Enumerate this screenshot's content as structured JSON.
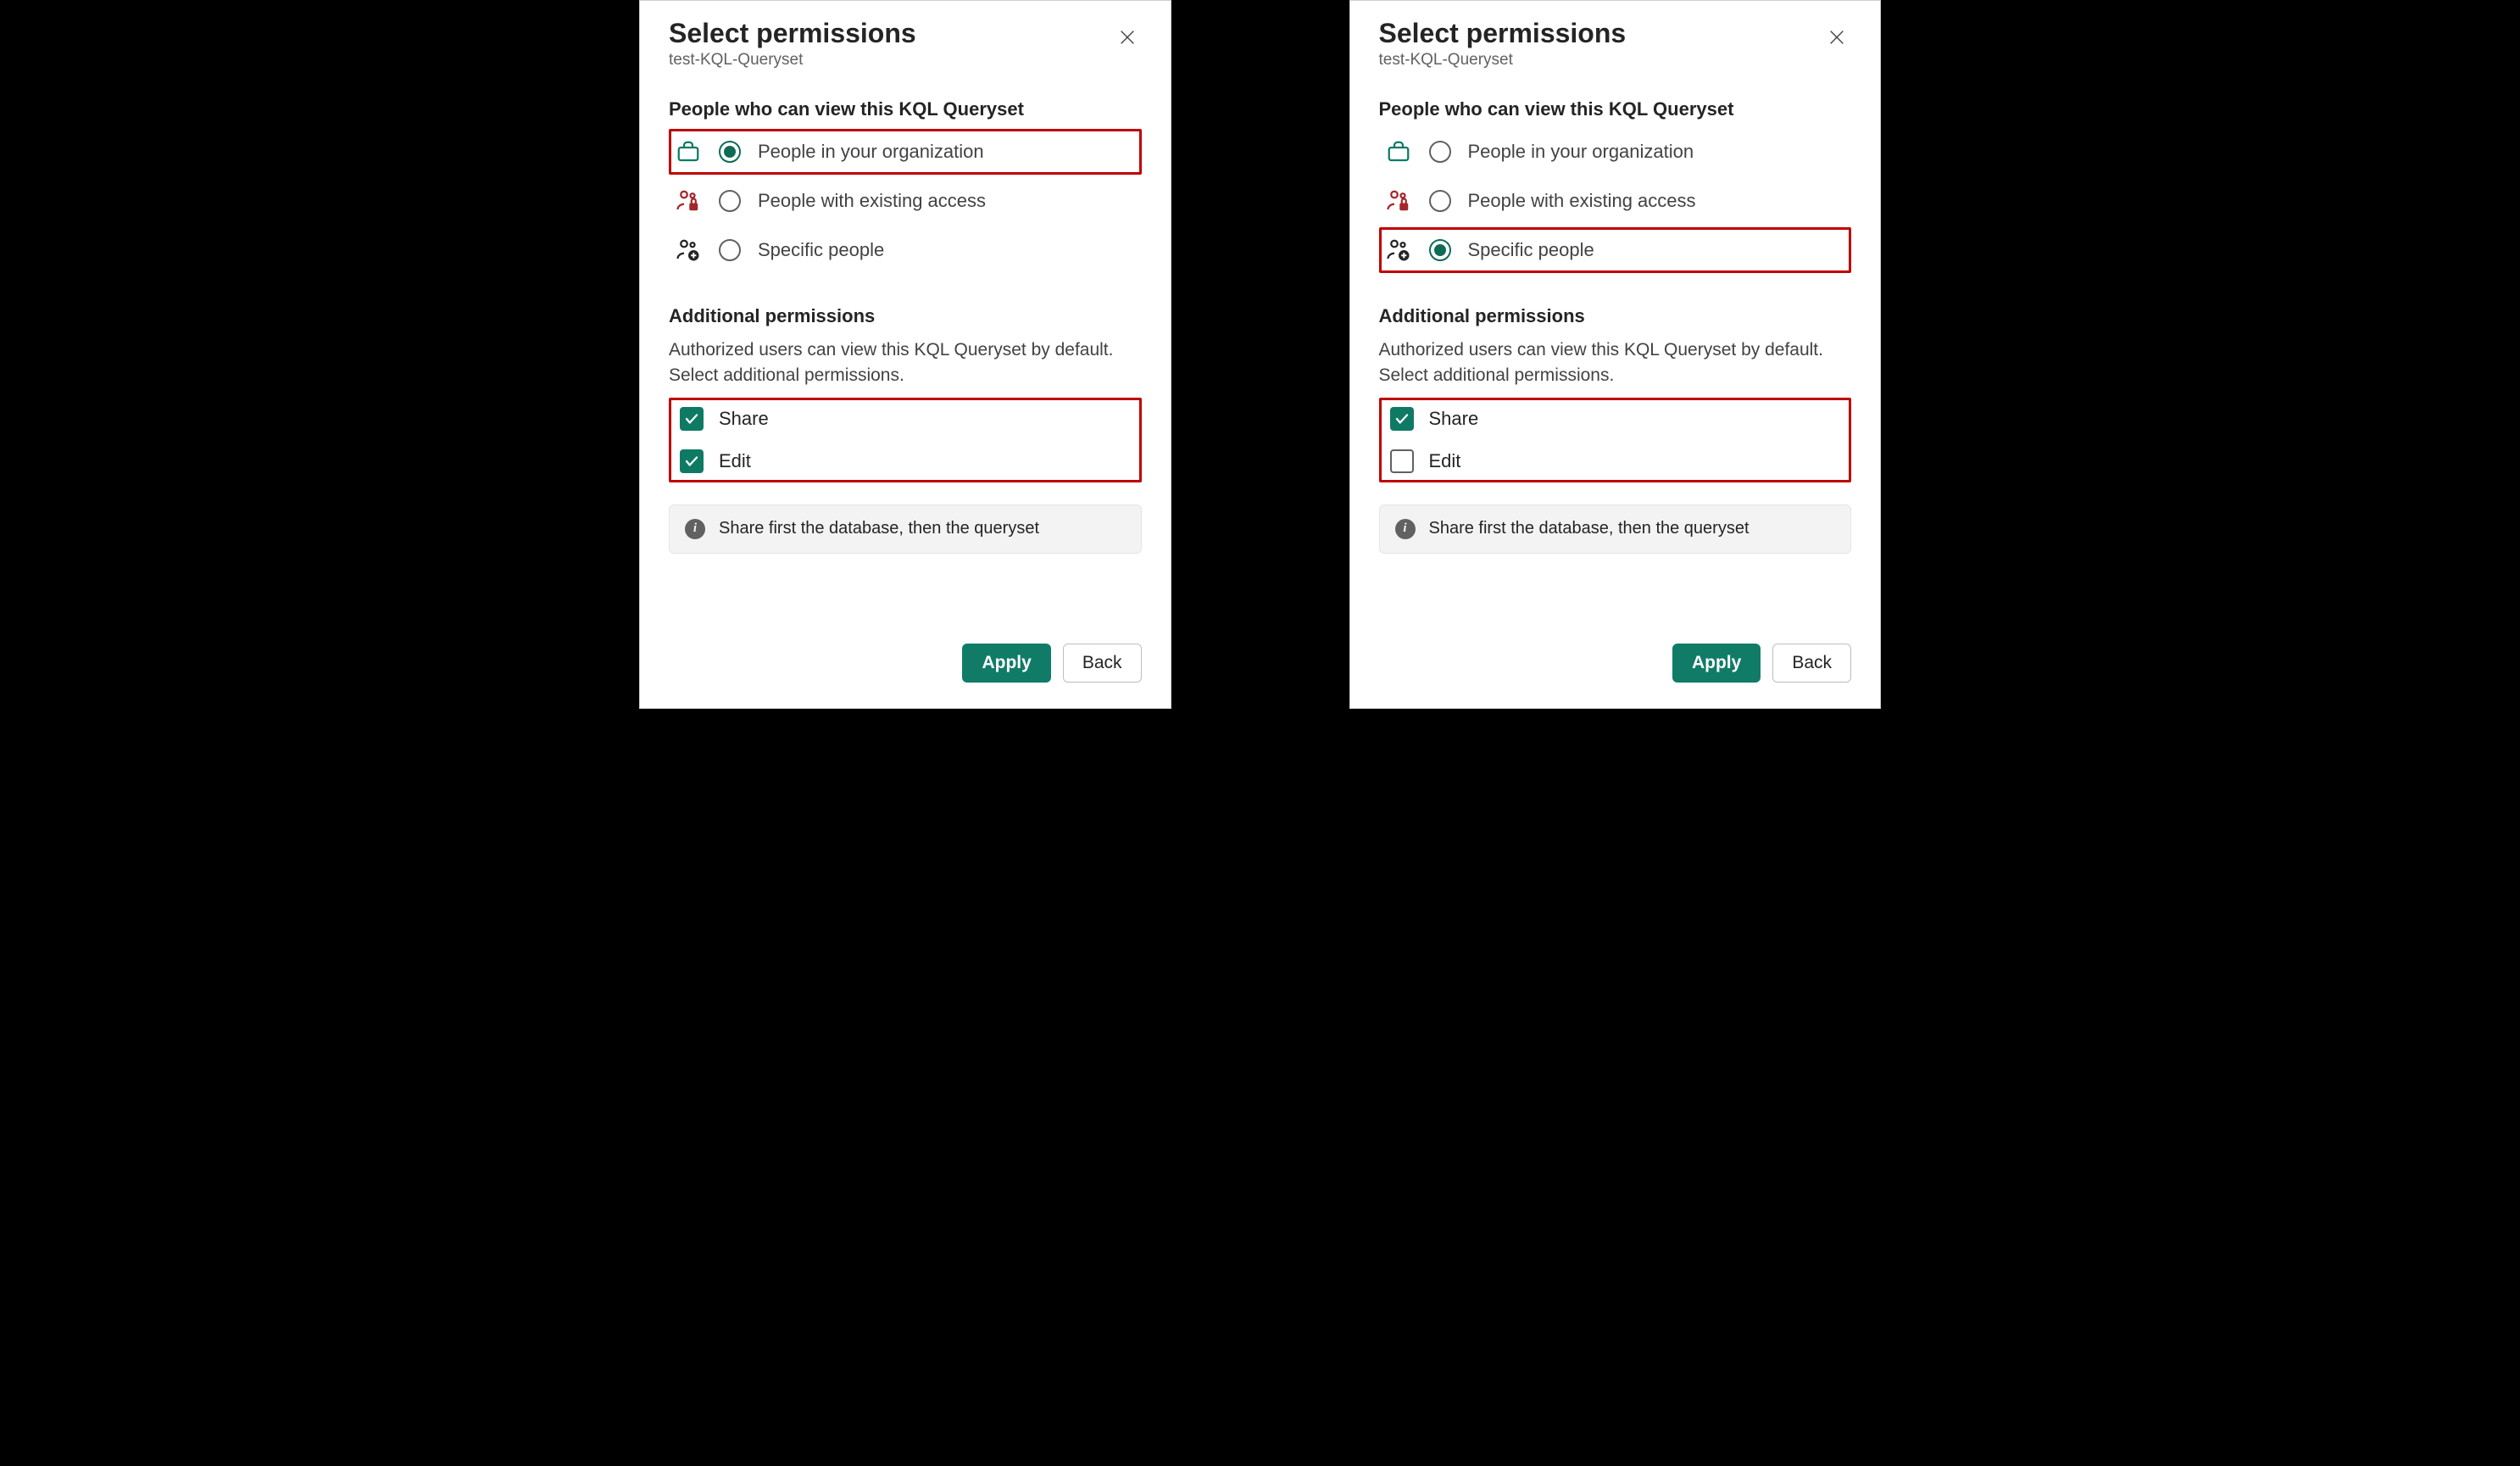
{
  "panels": [
    {
      "title": "Select permissions",
      "subtitle": "test-KQL-Queryset",
      "view_section_label": "People who can view this KQL Queryset",
      "radios": [
        {
          "label": "People in your organization",
          "selected": true,
          "highlight": true,
          "icon": "briefcase"
        },
        {
          "label": "People with existing access",
          "selected": false,
          "highlight": false,
          "icon": "people-lock"
        },
        {
          "label": "Specific people",
          "selected": false,
          "highlight": false,
          "icon": "people-add"
        }
      ],
      "additional_label": "Additional permissions",
      "additional_desc": "Authorized users can view this KQL Queryset by default. Select additional permissions.",
      "checkboxes_highlight": true,
      "checkboxes": [
        {
          "label": "Share",
          "checked": true
        },
        {
          "label": "Edit",
          "checked": true
        }
      ],
      "info_text": "Share first the database, then the queryset",
      "apply_label": "Apply",
      "back_label": "Back"
    },
    {
      "title": "Select permissions",
      "subtitle": "test-KQL-Queryset",
      "view_section_label": "People who can view this KQL Queryset",
      "radios": [
        {
          "label": "People in your organization",
          "selected": false,
          "highlight": false,
          "icon": "briefcase"
        },
        {
          "label": "People with existing access",
          "selected": false,
          "highlight": false,
          "icon": "people-lock"
        },
        {
          "label": "Specific people",
          "selected": true,
          "highlight": true,
          "icon": "people-add"
        }
      ],
      "additional_label": "Additional permissions",
      "additional_desc": "Authorized users can view this KQL Queryset by default. Select additional permissions.",
      "checkboxes_highlight": true,
      "checkboxes": [
        {
          "label": "Share",
          "checked": true
        },
        {
          "label": "Edit",
          "checked": false
        }
      ],
      "info_text": "Share first the database, then the queryset",
      "apply_label": "Apply",
      "back_label": "Back"
    }
  ]
}
